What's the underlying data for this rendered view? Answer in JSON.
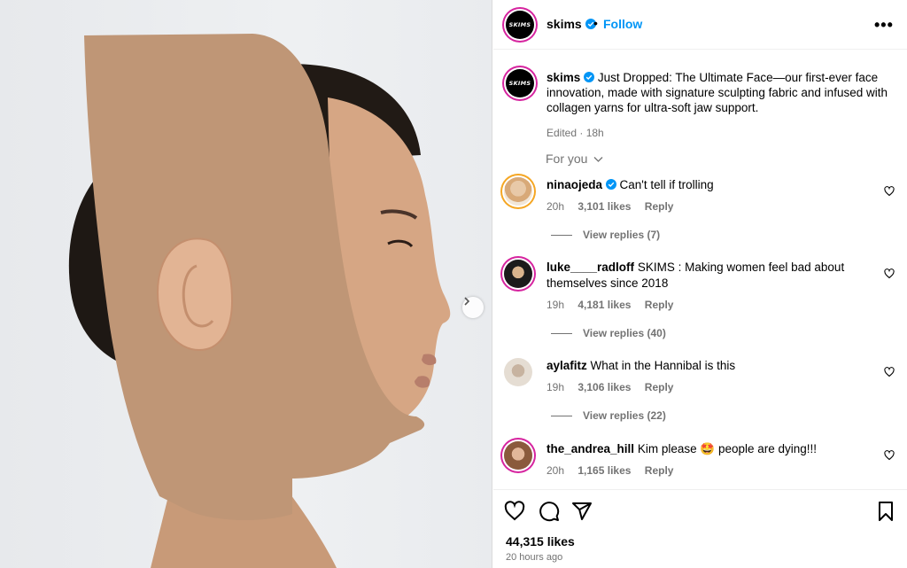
{
  "post": {
    "account": "skims",
    "logo_text": "SKIMS",
    "follow_label": "Follow",
    "separator": "•",
    "more_label": "•••",
    "caption": {
      "username": "skims",
      "text": "Just Dropped: The Ultimate Face—our first-ever face innovation, made with signature sculpting fabric and infused with collagen yarns for ultra-soft jaw support.",
      "edited": "Edited · 18h"
    },
    "sort_label": "For you",
    "likes": "44,315 likes",
    "time_ago": "20 hours ago"
  },
  "comments": [
    {
      "username": "ninaojeda",
      "verified": true,
      "text": "Can't tell if trolling",
      "time": "20h",
      "likes": "3,101 likes",
      "reply": "Reply",
      "view_replies": "View replies (7)"
    },
    {
      "username": "luke____radloff",
      "verified": false,
      "text": "SKIMS : Making women feel bad about themselves since 2018",
      "time": "19h",
      "likes": "4,181 likes",
      "reply": "Reply",
      "view_replies": "View replies (40)"
    },
    {
      "username": "aylafitz",
      "verified": false,
      "text": "What in the Hannibal is this",
      "time": "19h",
      "likes": "3,106 likes",
      "reply": "Reply",
      "view_replies": "View replies (22)"
    },
    {
      "username": "the_andrea_hill",
      "verified": false,
      "text_before": "Kim please",
      "emoji": "🤩",
      "text_after": "people are dying!!!",
      "time": "20h",
      "likes": "1,165 likes",
      "reply": "Reply"
    }
  ],
  "icons": {
    "like": "heart-icon",
    "comment": "comment-icon",
    "share": "share-icon",
    "save": "bookmark-icon",
    "verified": "verified-badge-icon",
    "next": "chevron-right-icon"
  },
  "colors": {
    "accent": "#0095f6",
    "muted": "#737373",
    "verified": "#0095f6",
    "story_ring": "#d6249f"
  }
}
